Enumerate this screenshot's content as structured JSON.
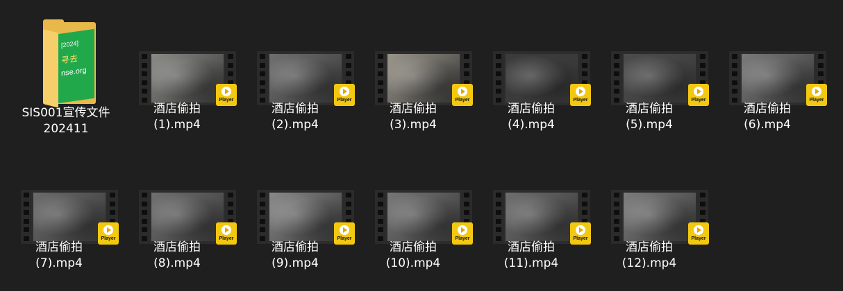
{
  "folder": {
    "line1": "SIS001宣传文件",
    "line2": "202411",
    "doc_text": [
      "[2024]",
      "寻去",
      "nse.org"
    ],
    "icon": "folder-icon"
  },
  "badge_text": "Player",
  "files": [
    {
      "line1": "酒店偷拍",
      "line2": "(1).mp4",
      "tone": "#8a8a86"
    },
    {
      "line1": "酒店偷拍",
      "line2": "(2).mp4",
      "tone": "#6f6f6f"
    },
    {
      "line1": "酒店偷拍",
      "line2": "(3).mp4",
      "tone": "#9a958a"
    },
    {
      "line1": "酒店偷拍",
      "line2": "(4).mp4",
      "tone": "#3b3b3b"
    },
    {
      "line1": "酒店偷拍",
      "line2": "(5).mp4",
      "tone": "#4c4c4c"
    },
    {
      "line1": "酒店偷拍",
      "line2": "(6).mp4",
      "tone": "#7a7a7a"
    },
    {
      "line1": "酒店偷拍",
      "line2": "(7).mp4",
      "tone": "#6b6b6b"
    },
    {
      "line1": "酒店偷拍",
      "line2": "(8).mp4",
      "tone": "#707070"
    },
    {
      "line1": "酒店偷拍",
      "line2": "(9).mp4",
      "tone": "#8a8a8a"
    },
    {
      "line1": "酒店偷拍",
      "line2": "(10).mp4",
      "tone": "#777777"
    },
    {
      "line1": "酒店偷拍",
      "line2": "(11).mp4",
      "tone": "#6e6e6e"
    },
    {
      "line1": "酒店偷拍",
      "line2": "(12).mp4",
      "tone": "#7d7d7d"
    }
  ],
  "colors": {
    "background": "#1f1f1f",
    "badge": "#f2c811",
    "folder": "#e8b84a",
    "folder_doc": "#21a84a"
  }
}
